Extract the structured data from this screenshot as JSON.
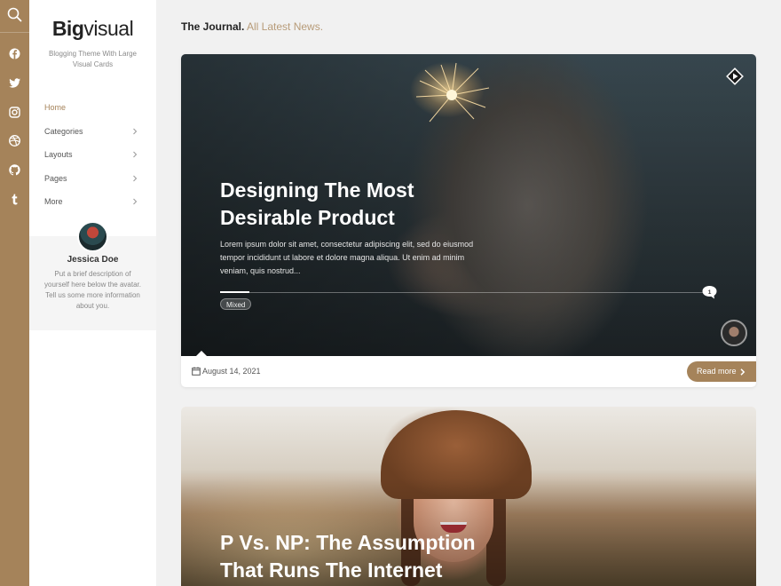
{
  "site": {
    "logo_bold": "Big",
    "logo_light": "visual",
    "tagline": "Blogging Theme With Large Visual Cards"
  },
  "rail": {
    "icons": [
      "search-icon",
      "facebook-icon",
      "twitter-icon",
      "instagram-icon",
      "dribbble-icon",
      "github-icon",
      "tumblr-icon"
    ]
  },
  "nav": {
    "items": [
      {
        "label": "Home",
        "active": true,
        "has_submenu": false
      },
      {
        "label": "Categories",
        "active": false,
        "has_submenu": true
      },
      {
        "label": "Layouts",
        "active": false,
        "has_submenu": true
      },
      {
        "label": "Pages",
        "active": false,
        "has_submenu": true
      },
      {
        "label": "More",
        "active": false,
        "has_submenu": true
      }
    ]
  },
  "author": {
    "name": "Jessica Doe",
    "description": "Put a brief description of yourself here below the avatar. Tell us some more information about you."
  },
  "page": {
    "heading_bold": "The Journal.",
    "heading_light": "All Latest News."
  },
  "posts": [
    {
      "title": "Designing The Most Desirable Product",
      "excerpt": "Lorem ipsum dolor sit amet, consectetur adipiscing elit, sed do eiusmod tempor incididunt ut labore et dolore magna aliqua. Ut enim ad minim veniam, quis nostrud...",
      "category": "Mixed",
      "comments": "1",
      "date": "August 14, 2021",
      "read_more": "Read more",
      "format": "video"
    },
    {
      "title": "P Vs. NP: The Assumption That Runs The Internet"
    }
  ],
  "colors": {
    "accent": "#a5835a",
    "heading_light": "#b79b78",
    "sidebar_bg": "#ffffff",
    "page_bg": "#f1f1f1"
  }
}
